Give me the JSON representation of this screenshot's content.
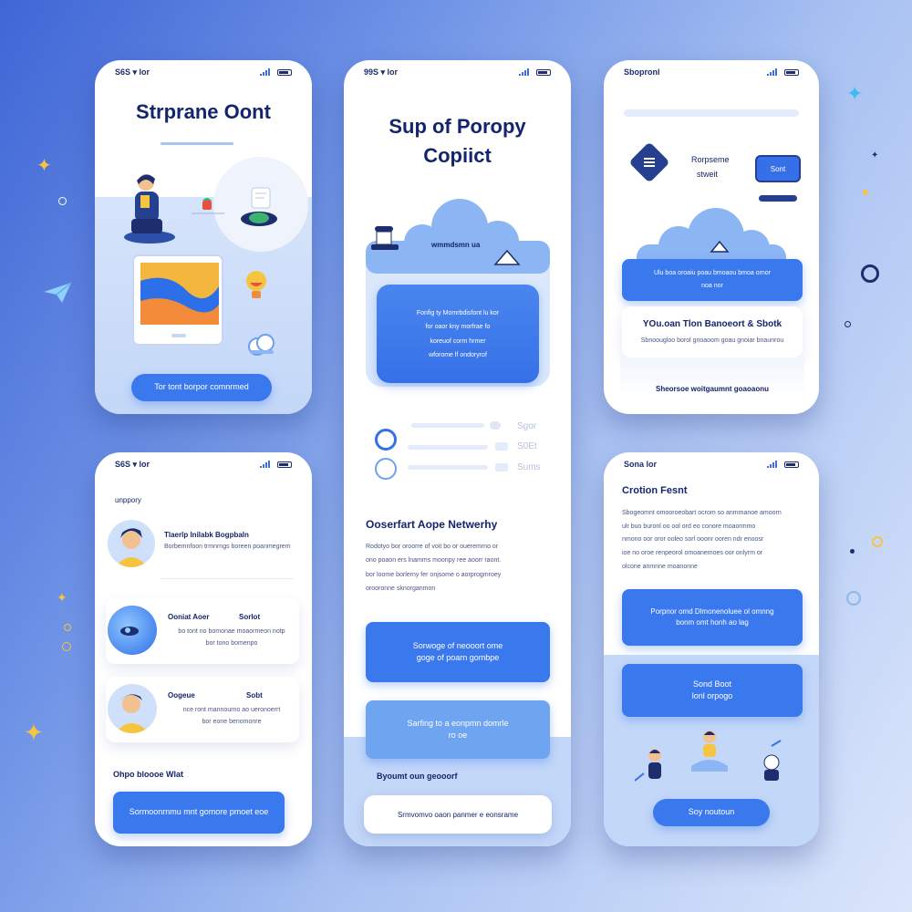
{
  "screen1": {
    "status_time": "S6S ▾ lor",
    "title": "Strprane Oont",
    "button": "Tor tont borpor comnrmed"
  },
  "screen2": {
    "status_time": "99S ▾ lor",
    "title_line1": "Sup of Poropy",
    "title_line2": "Copiict",
    "cloud_label": "wmmdsmn ua",
    "card_text": "Fonfig ty Momrbdisfont lu kor\nfor oaor kny morfrae fo\nkoreuof corm hrmer\nwforome lf ondoryrof",
    "progress_labels": [
      "Sgor",
      "S0Et",
      "Sums"
    ],
    "section_title": "Ooserfart Aope Netwerhy",
    "section_body": "Rodotyo bor oroorre of voit bo or oueremrno or\nono poaon ers lnamms moonpy ree aoorr raont.\nbor loome borlerny fer onjsome o aorprogmroey\norooronne sknorganmon",
    "button1": "Sorwoge of neooort ome\ngoge of poarn gombpe",
    "button2": "Sarfing to a eonpmn domrle\nro oe",
    "footer_label": "Byoumt oun geooorf",
    "footer_button": "Srmvomvo oaon panmer e eonsrame"
  },
  "screen3": {
    "status_time": "Sbopronl",
    "card_label_line1": "Rorpseme",
    "card_label_line2": "stweit",
    "small_button": "Sont",
    "blue_card_text": "Ulu boa oroaiu poau bmoaou bmoa ornor\nnoa nor",
    "card_title": "YOu.oan Tlon Banoeort & Sbotk",
    "card_sub": "Sbnoougloo borol gnoaoom goau gnoiar bnaunrou",
    "bottom_text": "Sheorsoe woitgaumnt goaoaonu"
  },
  "screen4": {
    "status_time": "S6S ▾ lor",
    "top_label": "unppory",
    "items": [
      {
        "title": "Tlaerlp lnilabk Bogpbaln",
        "sub": "Borbemnfoon trmnrngs boreen poanmegrem"
      },
      {
        "title": "Ooniat Aoer",
        "title2": "Sorlot",
        "sub": "bo tont no bomonae moaormeon notp\nbor tono bomenpo"
      },
      {
        "title": "Oogeue",
        "title2": "Sobt",
        "sub": "nce ront mannourno ao ueronoerrt\nbor eone benomonre"
      }
    ],
    "footer_label": "Ohpo bloooe Wlat",
    "button": "Sormoonrnmu mnt gomore pmoet eoe"
  },
  "screen5": {
    "status_time": "Sona lor",
    "title": "Crotion Fesnt",
    "body": "Sbogeomnt omooroeobart ocrom so anmmanoe amoorn\nulr buo buronl oo ool ord eo conore moaormmo\nnmono oor oror ooleo sorl ooonr ooren ndr enoosr\nioe no oroe renpeorol omoanemoes oor onlyrm or\nolcone anmnne moanonne",
    "button1": "Porpnor omd Dlmonenoluee ol omnng\nbonm omt honh ao lag",
    "button2": "Sond Boot\nlonl orpogo",
    "button3": "Soy noutoun"
  }
}
